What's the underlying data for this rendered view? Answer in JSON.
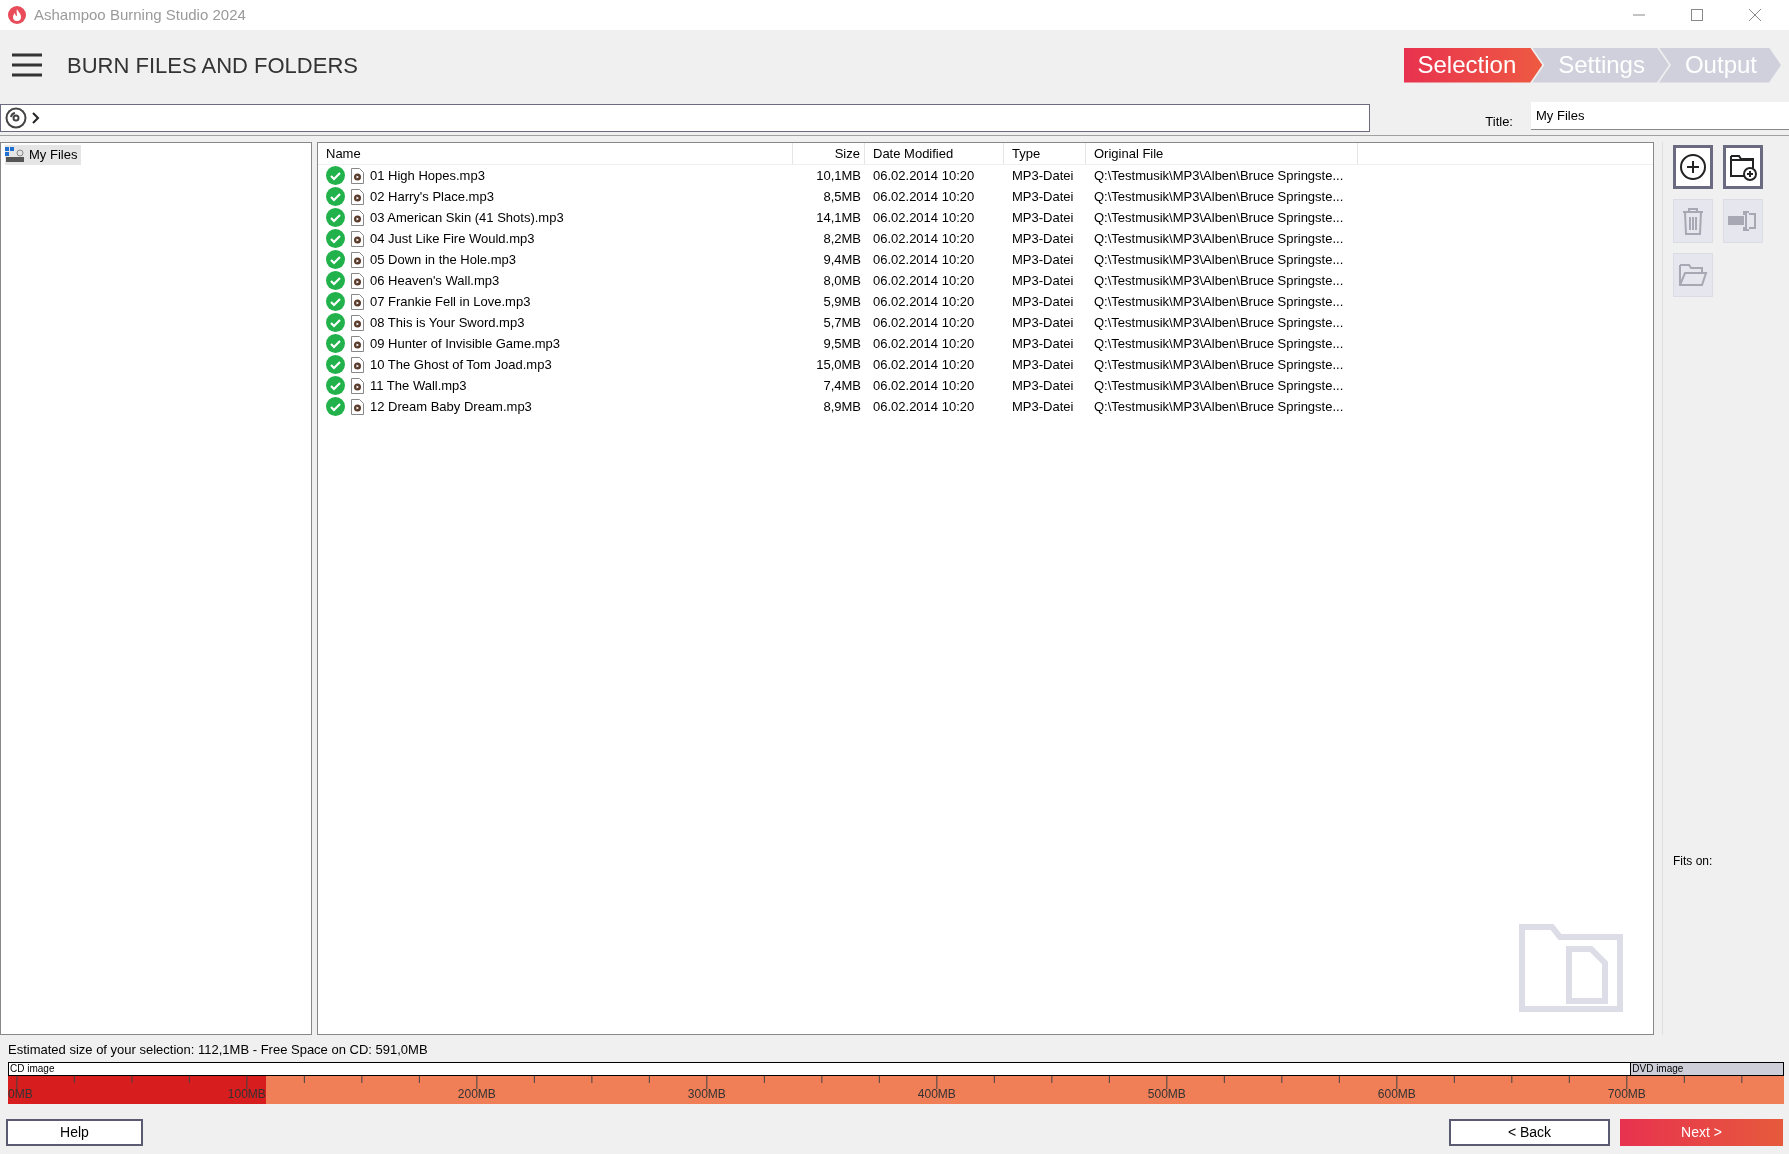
{
  "window": {
    "title": "Ashampoo Burning Studio 2024"
  },
  "header": {
    "title": "BURN FILES AND FOLDERS"
  },
  "steps": [
    {
      "label": "Selection",
      "selected": true
    },
    {
      "label": "Settings",
      "selected": false
    },
    {
      "label": "Output",
      "selected": false
    }
  ],
  "title_field": {
    "label": "Title:",
    "value": "My Files"
  },
  "tree": {
    "items": [
      {
        "label": "My Files",
        "selected": true
      }
    ]
  },
  "table": {
    "columns": [
      "Name",
      "Size",
      "Date Modified",
      "Type",
      "Original File"
    ],
    "rows": [
      {
        "name": "01 High Hopes.mp3",
        "size": "10,1MB",
        "date": "06.02.2014 10:20",
        "type": "MP3-Datei",
        "original": "Q:\\Testmusik\\MP3\\Alben\\Bruce Springste..."
      },
      {
        "name": "02 Harry's Place.mp3",
        "size": "8,5MB",
        "date": "06.02.2014 10:20",
        "type": "MP3-Datei",
        "original": "Q:\\Testmusik\\MP3\\Alben\\Bruce Springste..."
      },
      {
        "name": "03 American Skin (41 Shots).mp3",
        "size": "14,1MB",
        "date": "06.02.2014 10:20",
        "type": "MP3-Datei",
        "original": "Q:\\Testmusik\\MP3\\Alben\\Bruce Springste..."
      },
      {
        "name": "04 Just Like Fire Would.mp3",
        "size": "8,2MB",
        "date": "06.02.2014 10:20",
        "type": "MP3-Datei",
        "original": "Q:\\Testmusik\\MP3\\Alben\\Bruce Springste..."
      },
      {
        "name": "05 Down in the Hole.mp3",
        "size": "9,4MB",
        "date": "06.02.2014 10:20",
        "type": "MP3-Datei",
        "original": "Q:\\Testmusik\\MP3\\Alben\\Bruce Springste..."
      },
      {
        "name": "06 Heaven's Wall.mp3",
        "size": "8,0MB",
        "date": "06.02.2014 10:20",
        "type": "MP3-Datei",
        "original": "Q:\\Testmusik\\MP3\\Alben\\Bruce Springste..."
      },
      {
        "name": "07 Frankie Fell in Love.mp3",
        "size": "5,9MB",
        "date": "06.02.2014 10:20",
        "type": "MP3-Datei",
        "original": "Q:\\Testmusik\\MP3\\Alben\\Bruce Springste..."
      },
      {
        "name": "08 This is Your Sword.mp3",
        "size": "5,7MB",
        "date": "06.02.2014 10:20",
        "type": "MP3-Datei",
        "original": "Q:\\Testmusik\\MP3\\Alben\\Bruce Springste..."
      },
      {
        "name": "09 Hunter of Invisible Game.mp3",
        "size": "9,5MB",
        "date": "06.02.2014 10:20",
        "type": "MP3-Datei",
        "original": "Q:\\Testmusik\\MP3\\Alben\\Bruce Springste..."
      },
      {
        "name": "10 The Ghost of Tom Joad.mp3",
        "size": "15,0MB",
        "date": "06.02.2014 10:20",
        "type": "MP3-Datei",
        "original": "Q:\\Testmusik\\MP3\\Alben\\Bruce Springste..."
      },
      {
        "name": "11 The Wall.mp3",
        "size": "7,4MB",
        "date": "06.02.2014 10:20",
        "type": "MP3-Datei",
        "original": "Q:\\Testmusik\\MP3\\Alben\\Bruce Springste..."
      },
      {
        "name": "12 Dream Baby Dream.mp3",
        "size": "8,9MB",
        "date": "06.02.2014 10:20",
        "type": "MP3-Datei",
        "original": "Q:\\Testmusik\\MP3\\Alben\\Bruce Springste..."
      }
    ]
  },
  "toolbar": [
    {
      "kind": "add",
      "disabled": false
    },
    {
      "kind": "add-folder",
      "disabled": false
    },
    {
      "kind": "delete",
      "disabled": true
    },
    {
      "kind": "rename",
      "disabled": true
    },
    {
      "kind": "open-folder",
      "disabled": true
    }
  ],
  "fits_on": {
    "label": "Fits on:"
  },
  "status": {
    "text": "Estimated size of your selection: 112,1MB - Free Space on CD: 591,0MB"
  },
  "capacity": {
    "cd_label": "CD image",
    "dvd_label": "DVD image",
    "level": 0.145,
    "scale": [
      "0MB",
      "100MB",
      "200MB",
      "300MB",
      "400MB",
      "500MB",
      "600MB",
      "700MB"
    ]
  },
  "buttons": {
    "help": "Help",
    "back": "< Back",
    "next": "Next >"
  }
}
